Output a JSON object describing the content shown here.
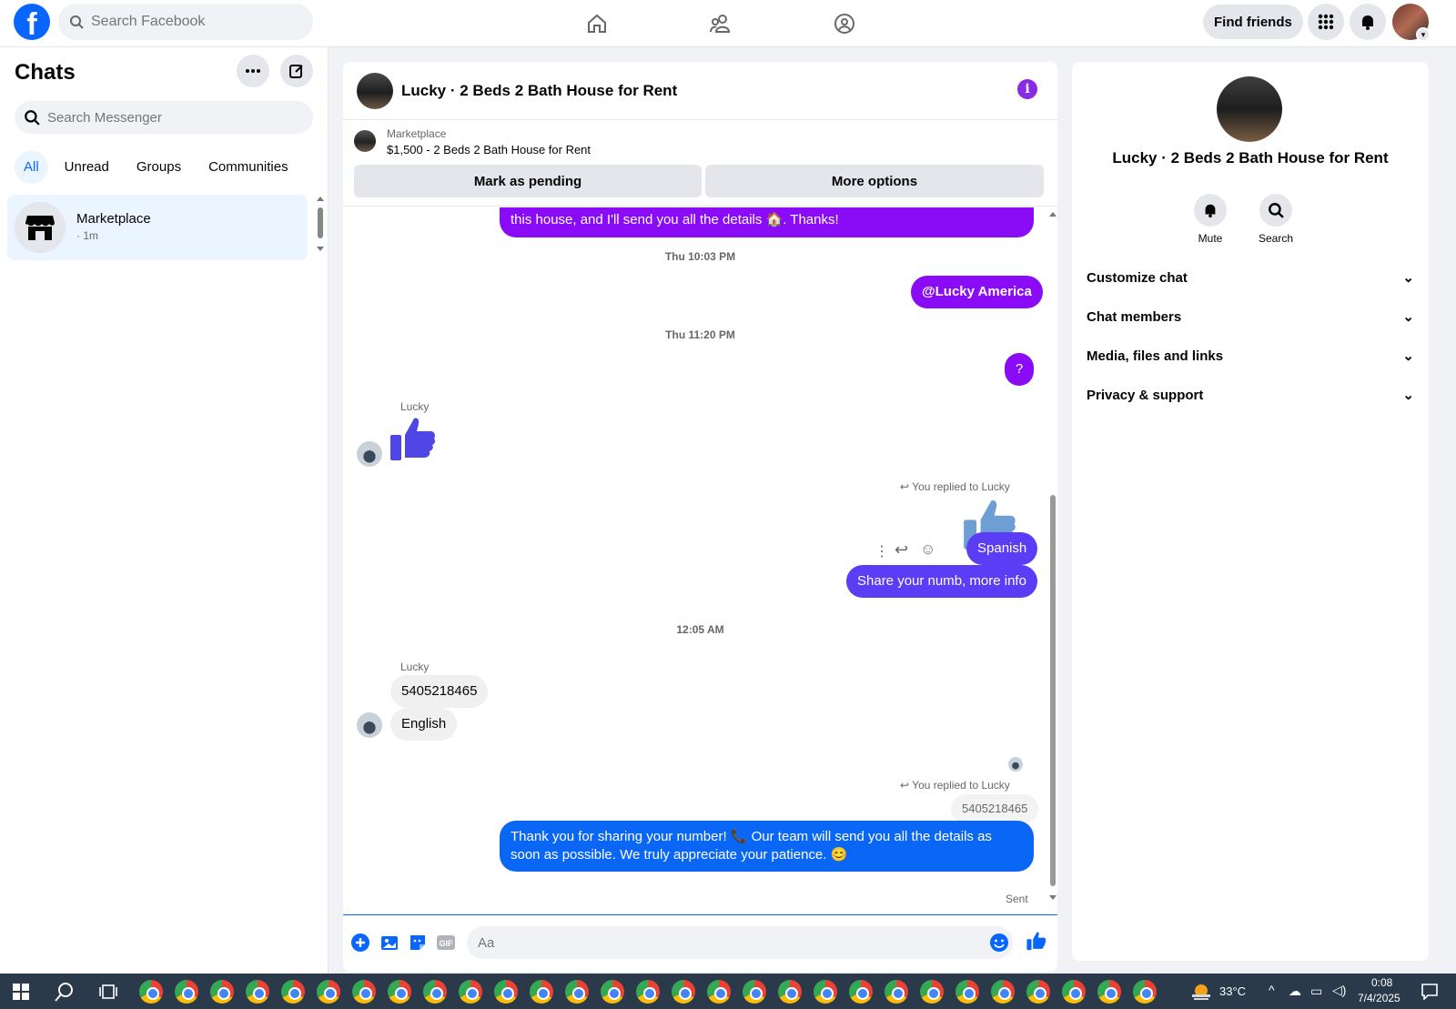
{
  "topbar": {
    "search_placeholder": "Search Facebook",
    "find_friends": "Find friends"
  },
  "left": {
    "title": "Chats",
    "search_placeholder": "Search Messenger",
    "filters": [
      "All",
      "Unread",
      "Groups",
      "Communities"
    ],
    "chat": {
      "name": "Marketplace",
      "time": "· 1m"
    }
  },
  "conversation": {
    "title": "Lucky · 2 Beds 2 Bath House for Rent",
    "marketplace_label": "Marketplace",
    "listing": "$1,500 - 2 Beds 2 Bath House for Rent",
    "mark_pending": "Mark as pending",
    "more_options": "More options",
    "messages": {
      "m1": "this house, and I'll send you all the details 🏠. Thanks!",
      "ts1": "Thu 10:03 PM",
      "m2": "@Lucky America",
      "ts2": "Thu 11:20 PM",
      "m3": "?",
      "sender1": "Lucky",
      "replied1": "You replied to Lucky",
      "m4": "Spanish",
      "m5": "Share your numb, more info",
      "ts3": "12:05 AM",
      "sender2": "Lucky",
      "m6": "5405218465",
      "m7": "English",
      "replied2": "You replied to Lucky",
      "quoted": "5405218465",
      "m8": "Thank you for sharing your number! 📞 Our team will send you all the details as soon as possible. We truly appreciate your patience. 😊",
      "status": "Sent"
    },
    "composer_placeholder": "Aa"
  },
  "right": {
    "name": "Lucky · 2 Beds 2 Bath House for Rent",
    "actions": [
      "Mute",
      "Search"
    ],
    "rows": [
      "Customize chat",
      "Chat members",
      "Media, files and links",
      "Privacy & support"
    ]
  },
  "taskbar": {
    "temperature": "33°C",
    "time": "0:08",
    "date": "7/4/2025"
  },
  "colors": {
    "accent": "#0866ff",
    "purple_bubble": "#8a0bf5",
    "violet_bubble": "#5b3df5",
    "blue_bubble": "#0a66f5"
  }
}
